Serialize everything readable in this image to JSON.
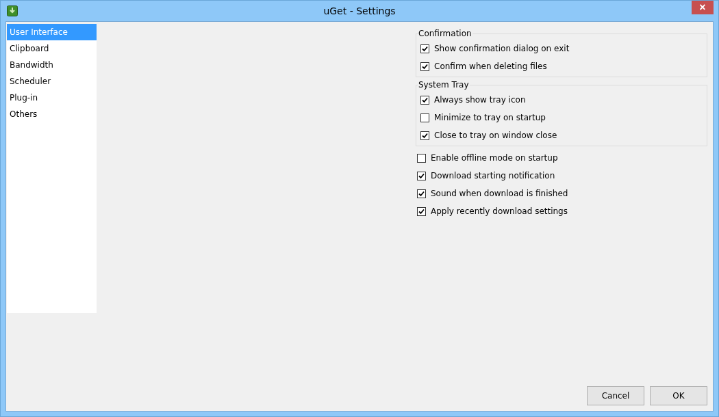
{
  "window": {
    "title": "uGet - Settings",
    "close_glyph": "×"
  },
  "sidebar": {
    "items": [
      {
        "label": "User Interface",
        "selected": true
      },
      {
        "label": "Clipboard",
        "selected": false
      },
      {
        "label": "Bandwidth",
        "selected": false
      },
      {
        "label": "Scheduler",
        "selected": false
      },
      {
        "label": "Plug-in",
        "selected": false
      },
      {
        "label": "Others",
        "selected": false
      }
    ]
  },
  "groups": [
    {
      "title": "Confirmation",
      "options": [
        {
          "label": "Show confirmation dialog on exit",
          "checked": true
        },
        {
          "label": "Confirm when deleting files",
          "checked": true
        }
      ]
    },
    {
      "title": "System Tray",
      "options": [
        {
          "label": "Always show tray icon",
          "checked": true
        },
        {
          "label": "Minimize to tray on startup",
          "checked": false
        },
        {
          "label": "Close to tray on window close",
          "checked": true
        }
      ]
    }
  ],
  "options": [
    {
      "label": "Enable offline mode on startup",
      "checked": false
    },
    {
      "label": "Download starting notification",
      "checked": true
    },
    {
      "label": "Sound when download is finished",
      "checked": true
    },
    {
      "label": "Apply recently download settings",
      "checked": true
    }
  ],
  "buttons": [
    "Cancel",
    "OK"
  ]
}
